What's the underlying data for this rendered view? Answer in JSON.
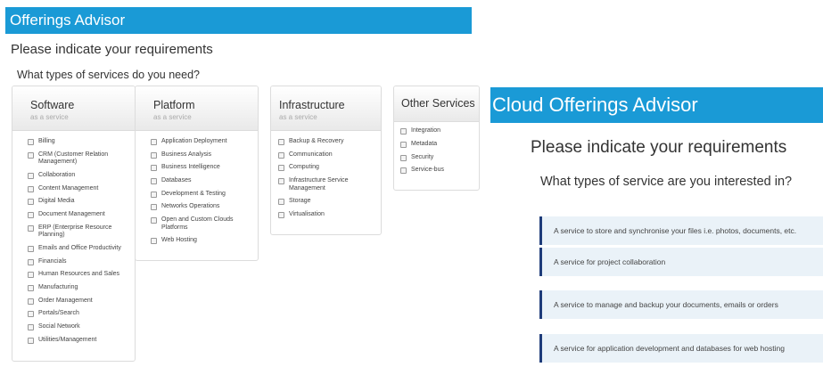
{
  "left": {
    "title": "Offerings Advisor",
    "heading": "Please indicate your requirements",
    "question": "What types of services do you need?",
    "categories": [
      {
        "name": "Software",
        "sub": "as a service",
        "items": [
          "Billing",
          "CRM (Customer Relation Management)",
          "Collaboration",
          "Content Management",
          "Digital Media",
          "Document Management",
          "ERP (Enterprise Resource Planning)",
          "Emails and Office Productivity",
          "Financials",
          "Human Resources and Sales",
          "Manufacturing",
          "Order Management",
          "Portals/Search",
          "Social Network",
          "Utilities/Management"
        ]
      },
      {
        "name": "Platform",
        "sub": "as a service",
        "items": [
          "Application Deployment",
          "Business Analysis",
          "Business Intelligence",
          "Databases",
          "Development & Testing",
          "Networks Operations",
          "Open and Custom Clouds Platforms",
          "Web Hosting"
        ]
      },
      {
        "name": "Infrastructure",
        "sub": "as a service",
        "items": [
          "Backup & Recovery",
          "Communication",
          "Computing",
          "Infrastructure Service Management",
          "Storage",
          "Virtualisation"
        ]
      },
      {
        "name": "Other Services",
        "items": [
          "Integration",
          "Metadata",
          "Security",
          "Service-bus"
        ]
      }
    ]
  },
  "right": {
    "title": "Cloud Offerings Advisor",
    "heading": "Please indicate your requirements",
    "question": "What types of service are you interested in?",
    "options": [
      "A service to store and synchronise your files i.e. photos, documents, etc.",
      "A service for project collaboration",
      "A service to manage and backup your documents, emails or orders",
      "A service for application development and databases for web hosting"
    ]
  }
}
